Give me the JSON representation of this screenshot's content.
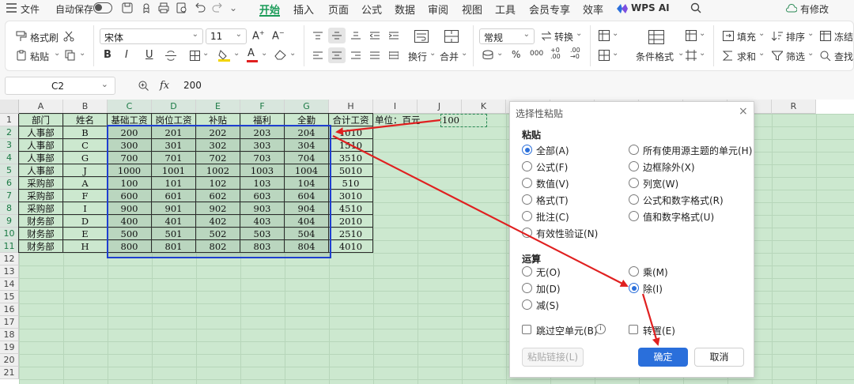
{
  "menu": {
    "file": "文件",
    "autosave": "自动保存",
    "tabs": [
      "开始",
      "插入",
      "页面",
      "公式",
      "数据",
      "审阅",
      "视图",
      "工具",
      "会员专享",
      "效率"
    ],
    "wps_ai": "WPS AI",
    "edit_status": "有修改"
  },
  "ribbon": {
    "format_painter": "格式刷",
    "paste": "粘贴",
    "font_name": "宋体",
    "font_size": "11",
    "number_format": "常规",
    "convert": "转换",
    "wrap": "换行",
    "merge": "合并",
    "conditional_format": "条件格式",
    "fill": "填充",
    "sort": "排序",
    "freeze": "冻结",
    "sum": "求和",
    "filter": "筛选",
    "find": "查找",
    "bold": "B",
    "italic": "I",
    "underline": "U"
  },
  "formula_bar": {
    "name_box": "C2",
    "fx": "fx",
    "value": "200"
  },
  "sheet": {
    "columns": [
      "A",
      "B",
      "C",
      "D",
      "E",
      "F",
      "G",
      "H",
      "I",
      "J",
      "K",
      "L",
      "M",
      "N",
      "O",
      "P",
      "Q",
      "R"
    ],
    "rows": [
      "1",
      "2",
      "3",
      "4",
      "5",
      "6",
      "7",
      "8",
      "9",
      "10",
      "11",
      "12",
      "13",
      "14",
      "15",
      "16",
      "17",
      "18",
      "19",
      "20",
      "21"
    ],
    "header": [
      "部门",
      "姓名",
      "基础工资",
      "岗位工资",
      "补贴",
      "福利",
      "全勤",
      "合计工资"
    ],
    "unit_label": "单位：百元",
    "divisor": "100",
    "data": [
      [
        "人事部",
        "B",
        "200",
        "201",
        "202",
        "203",
        "204",
        "1010"
      ],
      [
        "人事部",
        "C",
        "300",
        "301",
        "302",
        "303",
        "304",
        "1510"
      ],
      [
        "人事部",
        "G",
        "700",
        "701",
        "702",
        "703",
        "704",
        "3510"
      ],
      [
        "人事部",
        "J",
        "1000",
        "1001",
        "1002",
        "1003",
        "1004",
        "5010"
      ],
      [
        "采购部",
        "A",
        "100",
        "101",
        "102",
        "103",
        "104",
        "510"
      ],
      [
        "采购部",
        "F",
        "600",
        "601",
        "602",
        "603",
        "604",
        "3010"
      ],
      [
        "采购部",
        "I",
        "900",
        "901",
        "902",
        "903",
        "904",
        "4510"
      ],
      [
        "财务部",
        "D",
        "400",
        "401",
        "402",
        "403",
        "404",
        "2010"
      ],
      [
        "财务部",
        "E",
        "500",
        "501",
        "502",
        "503",
        "504",
        "2510"
      ],
      [
        "财务部",
        "H",
        "800",
        "801",
        "802",
        "803",
        "804",
        "4010"
      ]
    ]
  },
  "dialog": {
    "title": "选择性粘贴",
    "paste_section": "粘贴",
    "paste_options": {
      "all": "全部(A)",
      "formula": "公式(F)",
      "values": "数值(V)",
      "formats": "格式(T)",
      "comments": "批注(C)",
      "validation": "有效性验证(N)",
      "all_theme": "所有使用源主题的单元(H)",
      "no_border": "边框除外(X)",
      "col_width": "列宽(W)",
      "formula_num": "公式和数字格式(R)",
      "value_num": "值和数字格式(U)"
    },
    "op_section": "运算",
    "op_options": {
      "none": "无(O)",
      "add": "加(D)",
      "sub": "减(S)",
      "mul": "乘(M)",
      "div": "除(I)"
    },
    "selected_paste": "全部(A)",
    "selected_op": "除(I)",
    "skip_blanks": "跳过空单元(B)",
    "transpose": "转置(E)",
    "paste_link": "粘贴链接(L)",
    "ok": "确定",
    "cancel": "取消"
  },
  "colors": {
    "accent_green": "#1a9b58",
    "sheet_bg": "#cce8cf",
    "selection_blue": "#1f3fd0",
    "annotation_red": "#e02020",
    "ok_button": "#2a6fdb"
  }
}
